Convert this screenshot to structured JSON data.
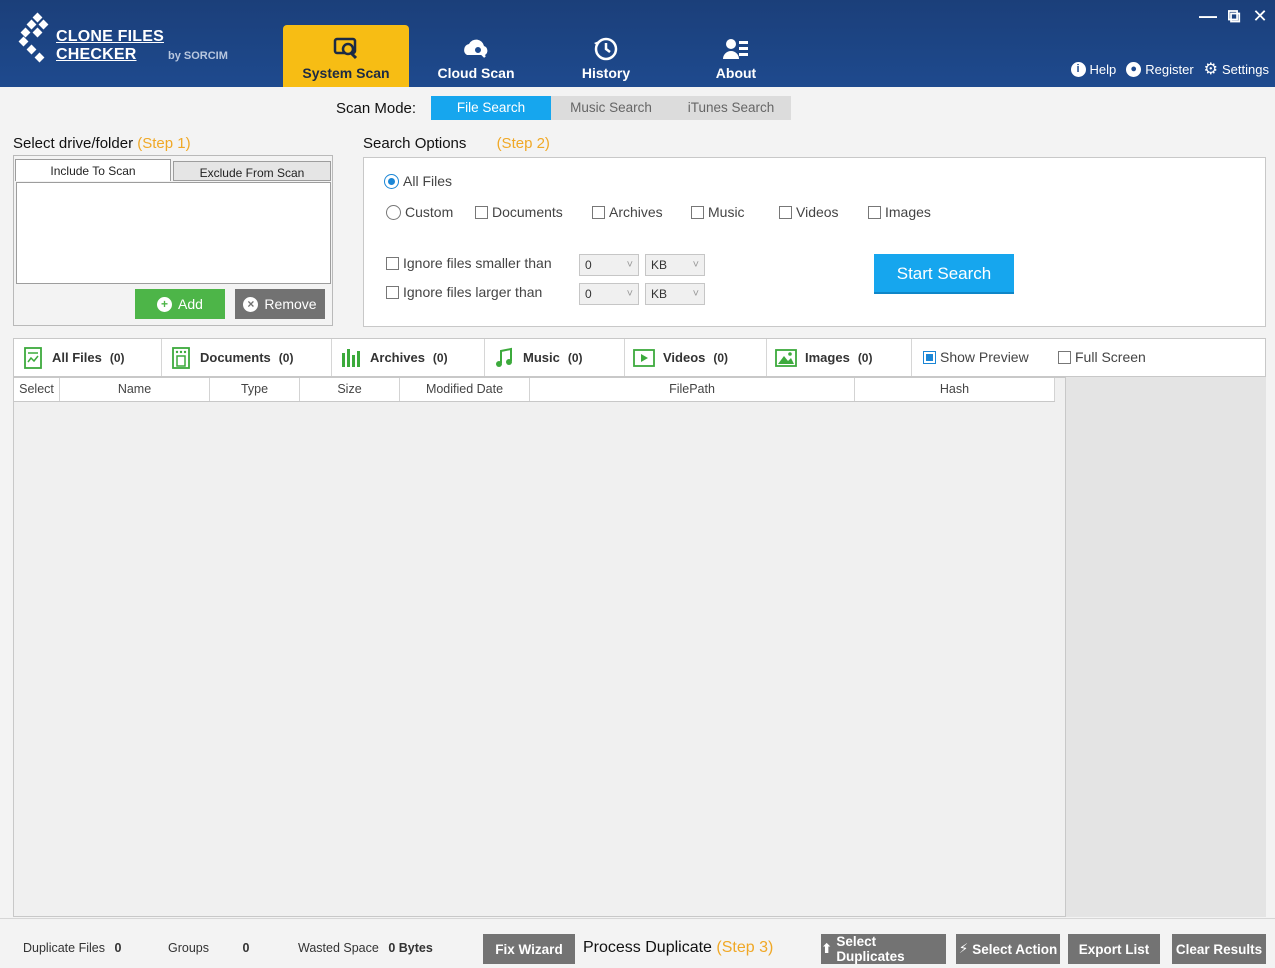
{
  "app": {
    "title": "CLONE FILES CHECKER",
    "subtitle": "by SORCIM"
  },
  "nav": {
    "tabs": [
      {
        "label": "System Scan",
        "icon": "system-scan-icon",
        "active": true
      },
      {
        "label": "Cloud Scan",
        "icon": "cloud-scan-icon",
        "active": false
      },
      {
        "label": "History",
        "icon": "history-icon",
        "active": false
      },
      {
        "label": "About",
        "icon": "about-icon",
        "active": false
      }
    ]
  },
  "window_controls": {
    "minimize": "—",
    "restore": "⧉",
    "close": "✕"
  },
  "top_links": {
    "help": "Help",
    "register": "Register",
    "settings": "Settings"
  },
  "scan_mode": {
    "label": "Scan Mode:",
    "options": [
      "File Search",
      "Music Search",
      "iTunes Search"
    ],
    "selected": "File Search"
  },
  "step1": {
    "title": "Select drive/folder",
    "step": "(Step 1)",
    "tabs": [
      "Include To Scan",
      "Exclude From Scan"
    ],
    "add_label": "Add",
    "remove_label": "Remove"
  },
  "step2": {
    "title": "Search Options",
    "step": "(Step 2)",
    "all_files": "All Files",
    "custom": "Custom",
    "types": [
      "Documents",
      "Archives",
      "Music",
      "Videos",
      "Images"
    ],
    "ignore_smaller": "Ignore files smaller than",
    "ignore_larger": "Ignore files larger than",
    "smaller_value": "0",
    "smaller_unit": "KB",
    "larger_value": "0",
    "larger_unit": "KB",
    "start_label": "Start Search"
  },
  "categories": [
    {
      "label": "All Files",
      "count": "(0)"
    },
    {
      "label": "Documents",
      "count": "(0)"
    },
    {
      "label": "Archives",
      "count": "(0)"
    },
    {
      "label": "Music",
      "count": "(0)"
    },
    {
      "label": "Videos",
      "count": "(0)"
    },
    {
      "label": "Images",
      "count": "(0)"
    }
  ],
  "toggles": {
    "show_preview": "Show Preview",
    "full_screen": "Full Screen"
  },
  "columns": [
    "Select",
    "Name",
    "Type",
    "Size",
    "Modified Date",
    "FilePath",
    "Hash"
  ],
  "footer": {
    "duplicate_files_label": "Duplicate Files",
    "duplicate_files_value": "0",
    "groups_label": "Groups",
    "groups_value": "0",
    "wasted_space_label": "Wasted Space",
    "wasted_space_value": "0 Bytes",
    "fix_wizard": "Fix Wizard",
    "process_label": "Process Duplicate",
    "process_step": "(Step 3)",
    "select_duplicates": "Select Duplicates",
    "select_action": "Select Action",
    "export_list": "Export List",
    "clear_results": "Clear Results"
  },
  "colors": {
    "header": "#1e4a8e",
    "active_tab": "#f7bd14",
    "accent_blue": "#16a6ee",
    "step_orange": "#f0a826",
    "add_green": "#4db548",
    "icon_green": "#3caa3c"
  }
}
